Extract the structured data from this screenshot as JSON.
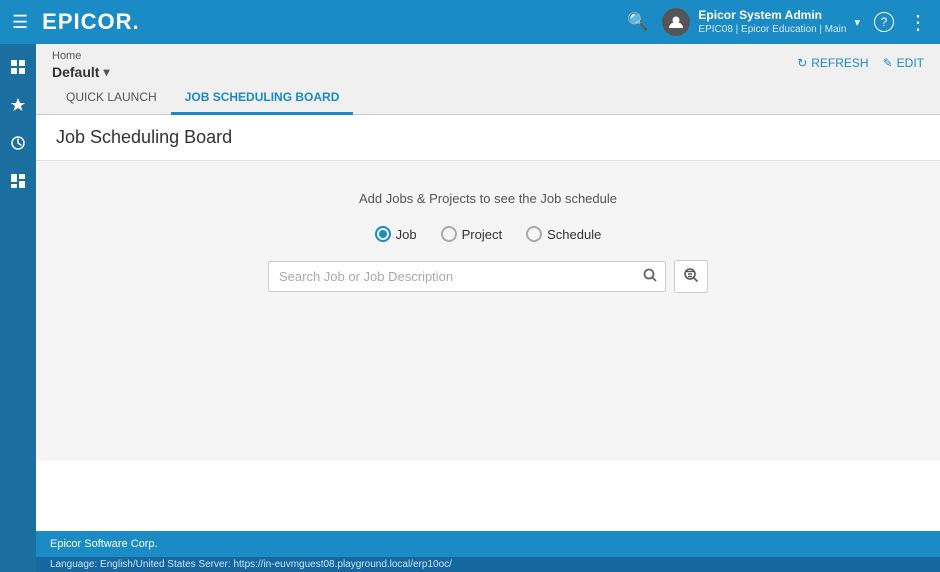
{
  "header": {
    "menu_icon": "☰",
    "logo_text": "EPICOR",
    "user_name": "Epicor System Admin",
    "user_sub": "EPIC08 | Epicor Education | Main",
    "search_icon": "🔍",
    "chevron": "▾",
    "help_icon": "?",
    "more_icon": "⋮"
  },
  "sidebar": {
    "items": [
      {
        "icon": "⊞",
        "name": "apps-icon"
      },
      {
        "icon": "♡",
        "name": "favorites-icon"
      },
      {
        "icon": "↺",
        "name": "history-icon"
      },
      {
        "icon": "⊟",
        "name": "dashboard-icon"
      }
    ]
  },
  "breadcrumb": {
    "home": "Home",
    "title": "Default",
    "chevron": "▾"
  },
  "actions": {
    "refresh_label": "REFRESH",
    "edit_label": "EDIT",
    "refresh_icon": "↻",
    "edit_icon": "✏"
  },
  "tabs": [
    {
      "label": "QUICK LAUNCH",
      "active": false
    },
    {
      "label": "JOB SCHEDULING BOARD",
      "active": true
    }
  ],
  "page": {
    "title": "Job Scheduling Board",
    "info_message": "Add Jobs & Projects to see the Job schedule",
    "radio_options": [
      {
        "label": "Job",
        "checked": true
      },
      {
        "label": "Project",
        "checked": false
      },
      {
        "label": "Schedule",
        "checked": false
      }
    ],
    "search_placeholder": "Search Job or Job Description",
    "search_icon": "🔍",
    "advanced_search_icon": "🔍"
  },
  "footer": {
    "company": "Epicor Software Corp.",
    "sub_text": "Language: English/United States    Server: https://in-euvmguest08.playground.local/erp10oc/"
  }
}
